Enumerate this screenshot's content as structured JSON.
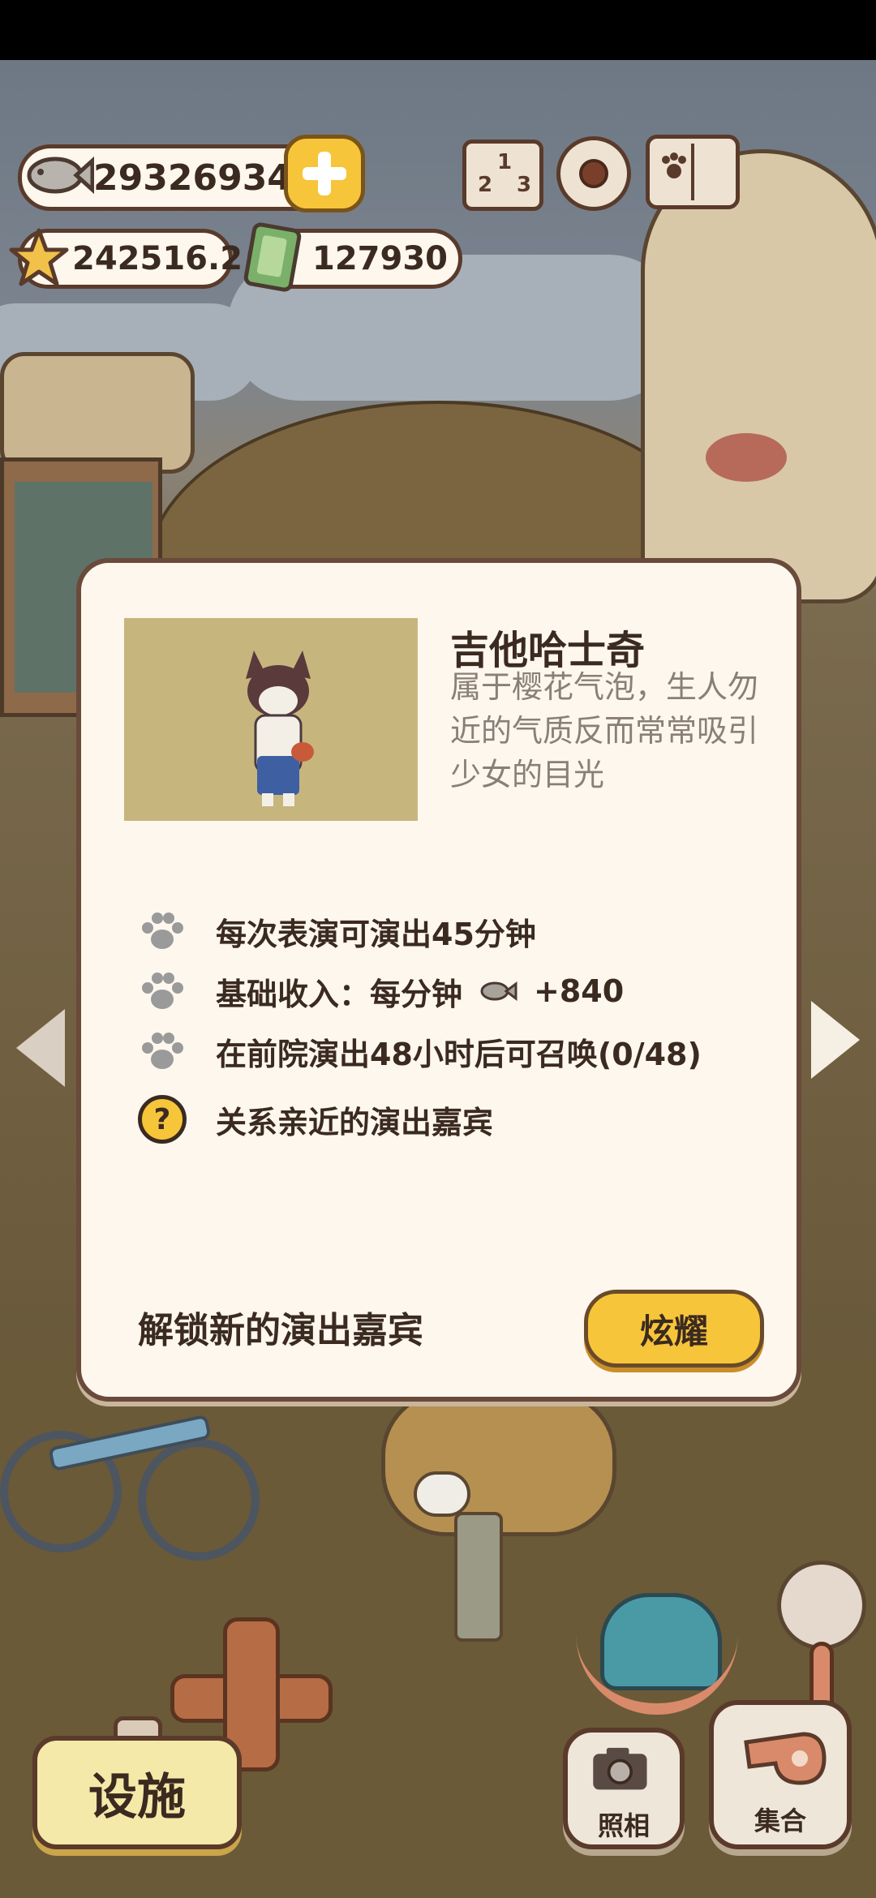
{
  "hud": {
    "fish_coins": "29326934",
    "stars": "242516.2",
    "tickets": "127930"
  },
  "dialog": {
    "character_name": "吉他哈士奇",
    "character_description": "属于樱花气泡，生人勿近的气质反而常常吸引少女的目光",
    "features": [
      {
        "icon": "paw-icon",
        "text": "每次表演可演出45分钟"
      },
      {
        "icon": "paw-icon",
        "text_prefix": "基础收入：每分钟",
        "value": "+840"
      },
      {
        "icon": "paw-icon",
        "text": "在前院演出48小时后可召唤(0/48)"
      },
      {
        "icon": "question-icon",
        "glyph": "?",
        "text": "关系亲近的演出嘉宾"
      }
    ],
    "unlock_label": "解锁新的演出嘉宾",
    "show_off_button": "炫耀"
  },
  "bottom": {
    "facility_button": "设施",
    "photo_button": "照相",
    "gather_button": "集合"
  },
  "colors": {
    "accent_yellow": "#f7c53a",
    "panel_cream": "#fdf7ee",
    "outline_brown": "#5a3a2a",
    "text_dark": "#3b2a20",
    "text_muted": "#8a7f76"
  }
}
